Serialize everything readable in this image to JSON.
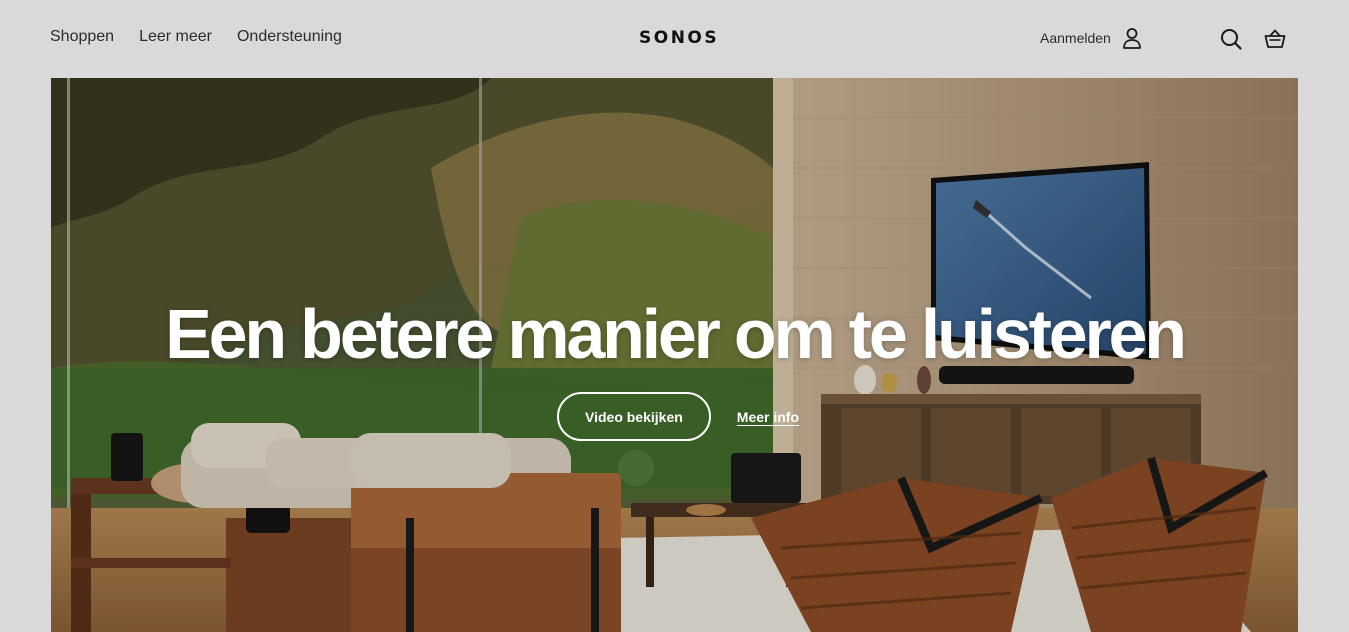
{
  "header": {
    "nav": [
      {
        "label": "Shoppen"
      },
      {
        "label": "Leer meer"
      },
      {
        "label": "Ondersteuning"
      }
    ],
    "logo": "SONOS",
    "signin_label": "Aanmelden",
    "icons": [
      "user-icon",
      "search-icon",
      "shopping-basket-icon"
    ]
  },
  "hero": {
    "title": "Een betere manier om te luisteren",
    "primary_cta": "Video bekijken",
    "secondary_cta": "Meer info"
  },
  "colors": {
    "background": "#d9d9d9",
    "text": "#2b2b2b",
    "hero_text": "#ffffff"
  }
}
